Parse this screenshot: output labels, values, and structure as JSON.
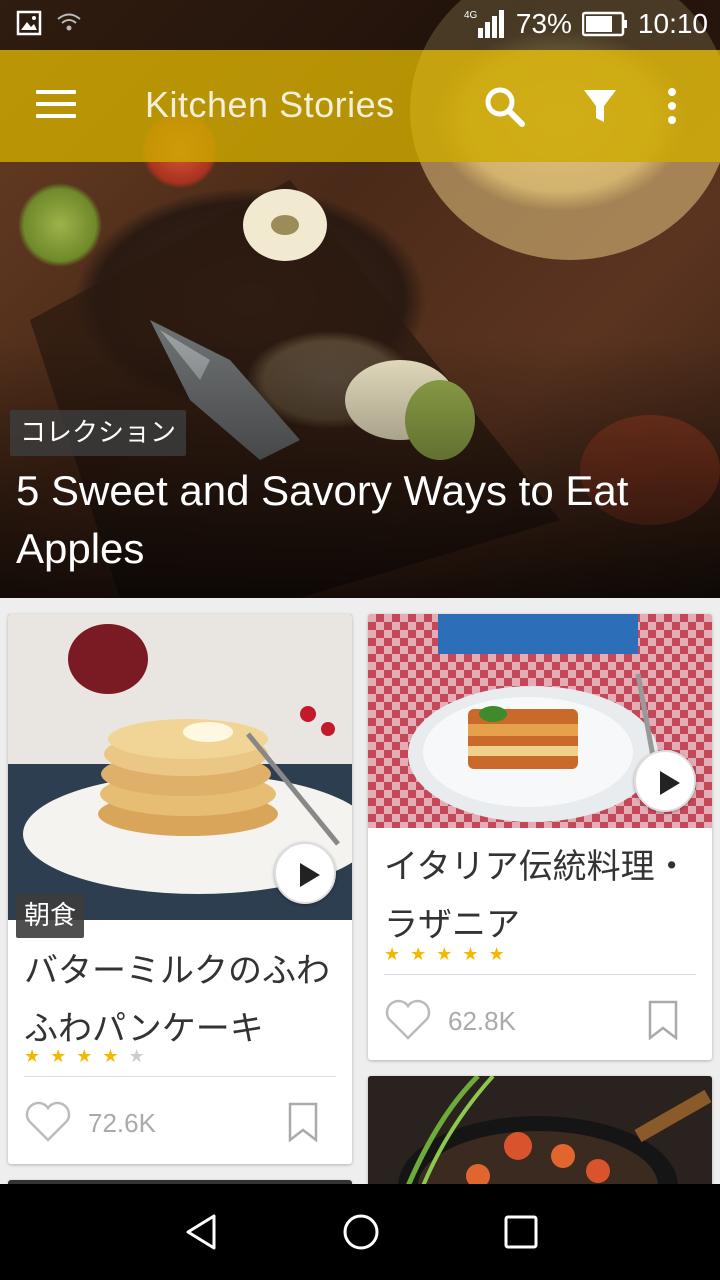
{
  "status_bar": {
    "network": "4G",
    "battery": "73%",
    "time": "10:10",
    "icons": [
      "image-icon",
      "wifi-icon",
      "signal-icon",
      "battery-icon"
    ]
  },
  "toolbar": {
    "title": "Kitchen Stories",
    "accent_color": "#cdaa00",
    "icons": [
      "menu-icon",
      "search-icon",
      "filter-icon",
      "more-vert-icon"
    ]
  },
  "hero": {
    "badge": "コレクション",
    "title": "5 Sweet and Savory Ways to Eat Apples"
  },
  "recipes": [
    {
      "category": "朝食",
      "title": "バターミルクのふわふわパンケーキ",
      "rating": 4.5,
      "likes": "72.6K",
      "has_video": true
    },
    {
      "title": "イタリア伝統料理・ラザニア",
      "rating": 5,
      "likes": "62.8K",
      "has_video": true
    }
  ],
  "star_color": "#f5b800",
  "nav_icons": [
    "back-icon",
    "home-icon",
    "recents-icon"
  ]
}
